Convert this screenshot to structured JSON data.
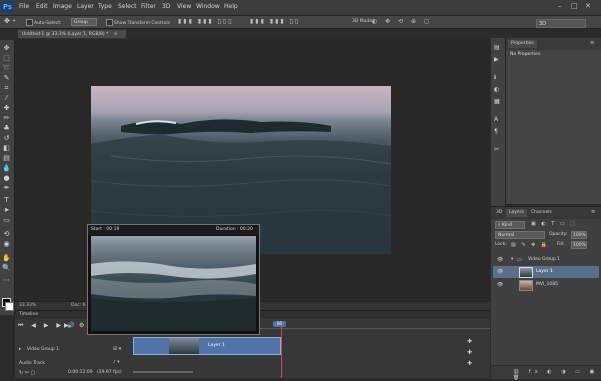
{
  "app": {
    "logo": "Ps"
  },
  "menu": [
    "File",
    "Edit",
    "Image",
    "Layer",
    "Type",
    "Select",
    "Filter",
    "3D",
    "View",
    "Window",
    "Help"
  ],
  "window_controls": {
    "minimize": "–",
    "maximize": "□",
    "close": "✕"
  },
  "options_bar": {
    "auto_select_label": "Auto-Select:",
    "auto_select_value": "Group",
    "show_transform_label": "Show Transform Controls",
    "mode_label": "3D Mode:",
    "workspace_value": "3D"
  },
  "document": {
    "tab_title": "Untitled-1 @ 33.3% (Layer 1, RGB/8) *"
  },
  "status_bar": {
    "zoom": "33.33%",
    "doc_label": "Doc: 6"
  },
  "preview": {
    "start_label": "Start : 00:19",
    "duration_label": "Duration : 00:20"
  },
  "timeline": {
    "title": "Timeline",
    "video_group_label": "Video Group 1",
    "audio_track_label": "Audio Track",
    "timecode": "0:00:12:09",
    "fps": "(29.97 fps)",
    "clip_label": "Layer 1",
    "playhead_label": "00"
  },
  "properties_panel": {
    "tab": "Properties",
    "content": "No Properties"
  },
  "layers_panel": {
    "tabs": [
      "3D",
      "Layers",
      "Channels"
    ],
    "kind_label": "Kind",
    "blend_mode": "Normal",
    "opacity_label": "Opacity:",
    "opacity_value": "100%",
    "lock_label": "Lock:",
    "fill_label": "Fill:",
    "fill_value": "100%",
    "layers": [
      {
        "name": "Video Group 1",
        "selected": false
      },
      {
        "name": "Layer 1",
        "selected": true
      },
      {
        "name": "MVI_1085",
        "selected": false
      }
    ]
  },
  "colors": {
    "accent_blue": "#4f74a8",
    "ps_blue": "#4fb6ff",
    "selection": "#5a6f8c"
  }
}
